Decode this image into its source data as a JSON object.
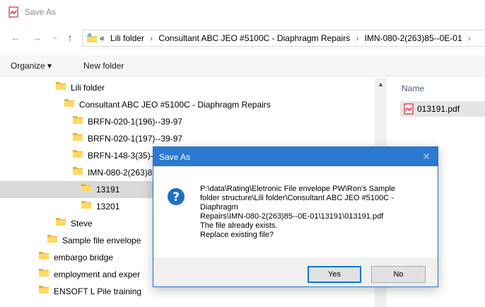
{
  "window": {
    "title": "Save As"
  },
  "nav": {
    "back": "←",
    "forward": "→",
    "recent": "⌄",
    "up": "↑",
    "overflow": "«",
    "breadcrumbs": [
      "Lili folder",
      "Consultant ABC JEO #5100C - Diaphragm Repairs",
      "IMN-080-2(263)85--0E-01"
    ],
    "separator": "›"
  },
  "toolbar": {
    "organize": "Organize ▾",
    "new_folder": "New folder"
  },
  "tree": [
    {
      "label": "Lili folder",
      "indent": 3
    },
    {
      "label": "Consultant ABC JEO #5100C - Diaphragm Repairs",
      "indent": 4
    },
    {
      "label": "BRFN-020-1(196)--39-97",
      "indent": 5
    },
    {
      "label": "BRFN-020-1(197)--39-97",
      "indent": 5
    },
    {
      "label": "BRFN-148-3(35)--",
      "indent": 5
    },
    {
      "label": "IMN-080-2(263)85",
      "indent": 5
    },
    {
      "label": "13191",
      "indent": 6,
      "selected": true
    },
    {
      "label": "13201",
      "indent": 6
    },
    {
      "label": "Steve",
      "indent": 3
    },
    {
      "label": "Sample file envelope",
      "indent": 2
    },
    {
      "label": "embargo bridge",
      "indent": 1
    },
    {
      "label": "employment and exper",
      "indent": 1
    },
    {
      "label": "ENSOFT L Pile  training",
      "indent": 1
    }
  ],
  "files": {
    "column_name": "Name",
    "items": [
      {
        "name": "013191.pdf"
      }
    ]
  },
  "dialog": {
    "title": "Save As",
    "close": "✕",
    "lines": [
      "P:\\data\\Rating\\Eletronic File envelope PW\\Ron's Sample",
      "folder structure\\Lili folder\\Consultant ABC JEO #5100C -",
      "Diaphragm",
      "Repairs\\IMN-080-2(263)85--0E-01\\13191\\013191.pdf",
      "The file already exists.",
      "Replace existing file?"
    ],
    "yes": "Yes",
    "no": "No"
  },
  "colors": {
    "accent": "#2b79d0",
    "folder": "#f4c244",
    "selected_bg": "#d9d9d9",
    "pdf_red": "#d9262c"
  }
}
